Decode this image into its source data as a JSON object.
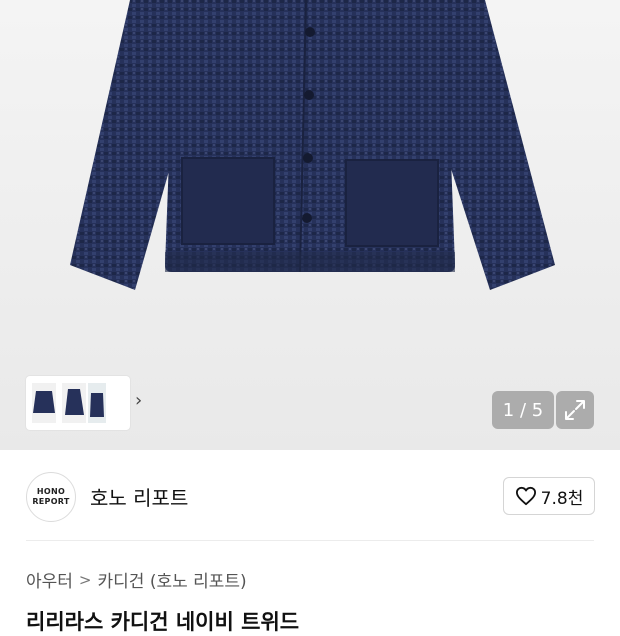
{
  "gallery": {
    "page_indicator": "1 / 5",
    "main_image": "navy-tweed-cardigan-photo",
    "thumbnails": [
      "cardigan-front",
      "cardigan-side",
      "cardigan-model"
    ]
  },
  "brand": {
    "logo_line1": "HONO",
    "logo_line2": "REPORT",
    "name": "호노 리포트",
    "like_count": "7.8천"
  },
  "breadcrumb": {
    "level1": "아우터",
    "separator": ">",
    "level2": "카디건 (호노 리포트)"
  },
  "product": {
    "title": "리리라스 카디건 네이비 트위드"
  },
  "colors": {
    "garment": "#26315a",
    "overlay": "#7a7a7a"
  }
}
